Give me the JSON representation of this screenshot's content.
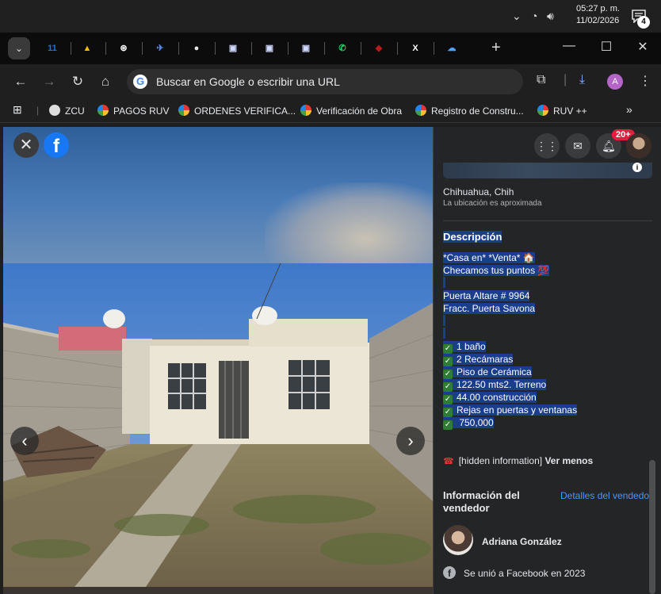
{
  "taskbar": {
    "time": "05:27 p. m.",
    "date": "11/02/2026",
    "notification_count": "4"
  },
  "tabs": [
    {
      "icon": "google-calendar-icon",
      "label": "11",
      "color": "#1a73e8"
    },
    {
      "icon": "google-drive-icon",
      "label": "▲",
      "color": "#fbbc04"
    },
    {
      "icon": "chatgpt-icon",
      "label": "⊛",
      "color": "#ffffff"
    },
    {
      "icon": "bird-icon",
      "label": "✈",
      "color": "#5b8def"
    },
    {
      "icon": "round-logo-icon",
      "label": "●",
      "color": "#e8e8e8"
    },
    {
      "icon": "doc-icon",
      "label": "▣",
      "color": "#cfd8ff"
    },
    {
      "icon": "doc-icon",
      "label": "▣",
      "color": "#cfd8ff"
    },
    {
      "icon": "doc-icon",
      "label": "▣",
      "color": "#cfd8ff"
    },
    {
      "icon": "whatsapp-icon",
      "label": "✆",
      "color": "#25d366"
    },
    {
      "icon": "shield-icon",
      "label": "◆",
      "color": "#b71c1c"
    },
    {
      "icon": "x-icon",
      "label": "X",
      "color": "#ffffff"
    },
    {
      "icon": "cloud-icon",
      "label": "☁",
      "color": "#4fa3ff"
    }
  ],
  "omnibox": {
    "placeholder": "Buscar en Google o escribir una URL"
  },
  "profile_initial": "A",
  "bookmarks": [
    {
      "label": "ZCU",
      "icon": "globe-icon"
    },
    {
      "label": "PAGOS RUV",
      "icon": "ruv-icon"
    },
    {
      "label": "ORDENES VERIFICA...",
      "icon": "ruv-icon"
    },
    {
      "label": "Verificación de Obra",
      "icon": "ruv-icon"
    },
    {
      "label": "Registro de Constru...",
      "icon": "ruv-icon"
    },
    {
      "label": "RUV ++",
      "icon": "ruv-icon"
    }
  ],
  "viewer": {
    "fb_logo": "f",
    "prev": "‹",
    "next": "›",
    "close": "✕"
  },
  "panel": {
    "notif_badge": "20+",
    "location": "Chihuahua, Chih",
    "location_note": "La ubicación es aproximada",
    "description_title": "Descripción",
    "description_lines": [
      "*Casa en* *Venta* 🏠",
      "Checamos tus puntos 💯",
      "",
      "Puerta Altare # 9964",
      "Fracc. Puerta Savona",
      "",
      ""
    ],
    "features": [
      "1 baño",
      "2 Recámaras",
      "Piso de Cerámica",
      "122.50 mts2. Terreno",
      "44.00  construcción",
      "Rejas en puertas y ventanas",
      " 750,000"
    ],
    "phone_hidden": "[hidden information]",
    "see_less": "Ver menos",
    "seller_section_title": "Información del vendedor",
    "seller_details_link": "Detalles del vendedor",
    "seller_name": "Adriana González",
    "joined": "Se unió a Facebook en 2023"
  }
}
